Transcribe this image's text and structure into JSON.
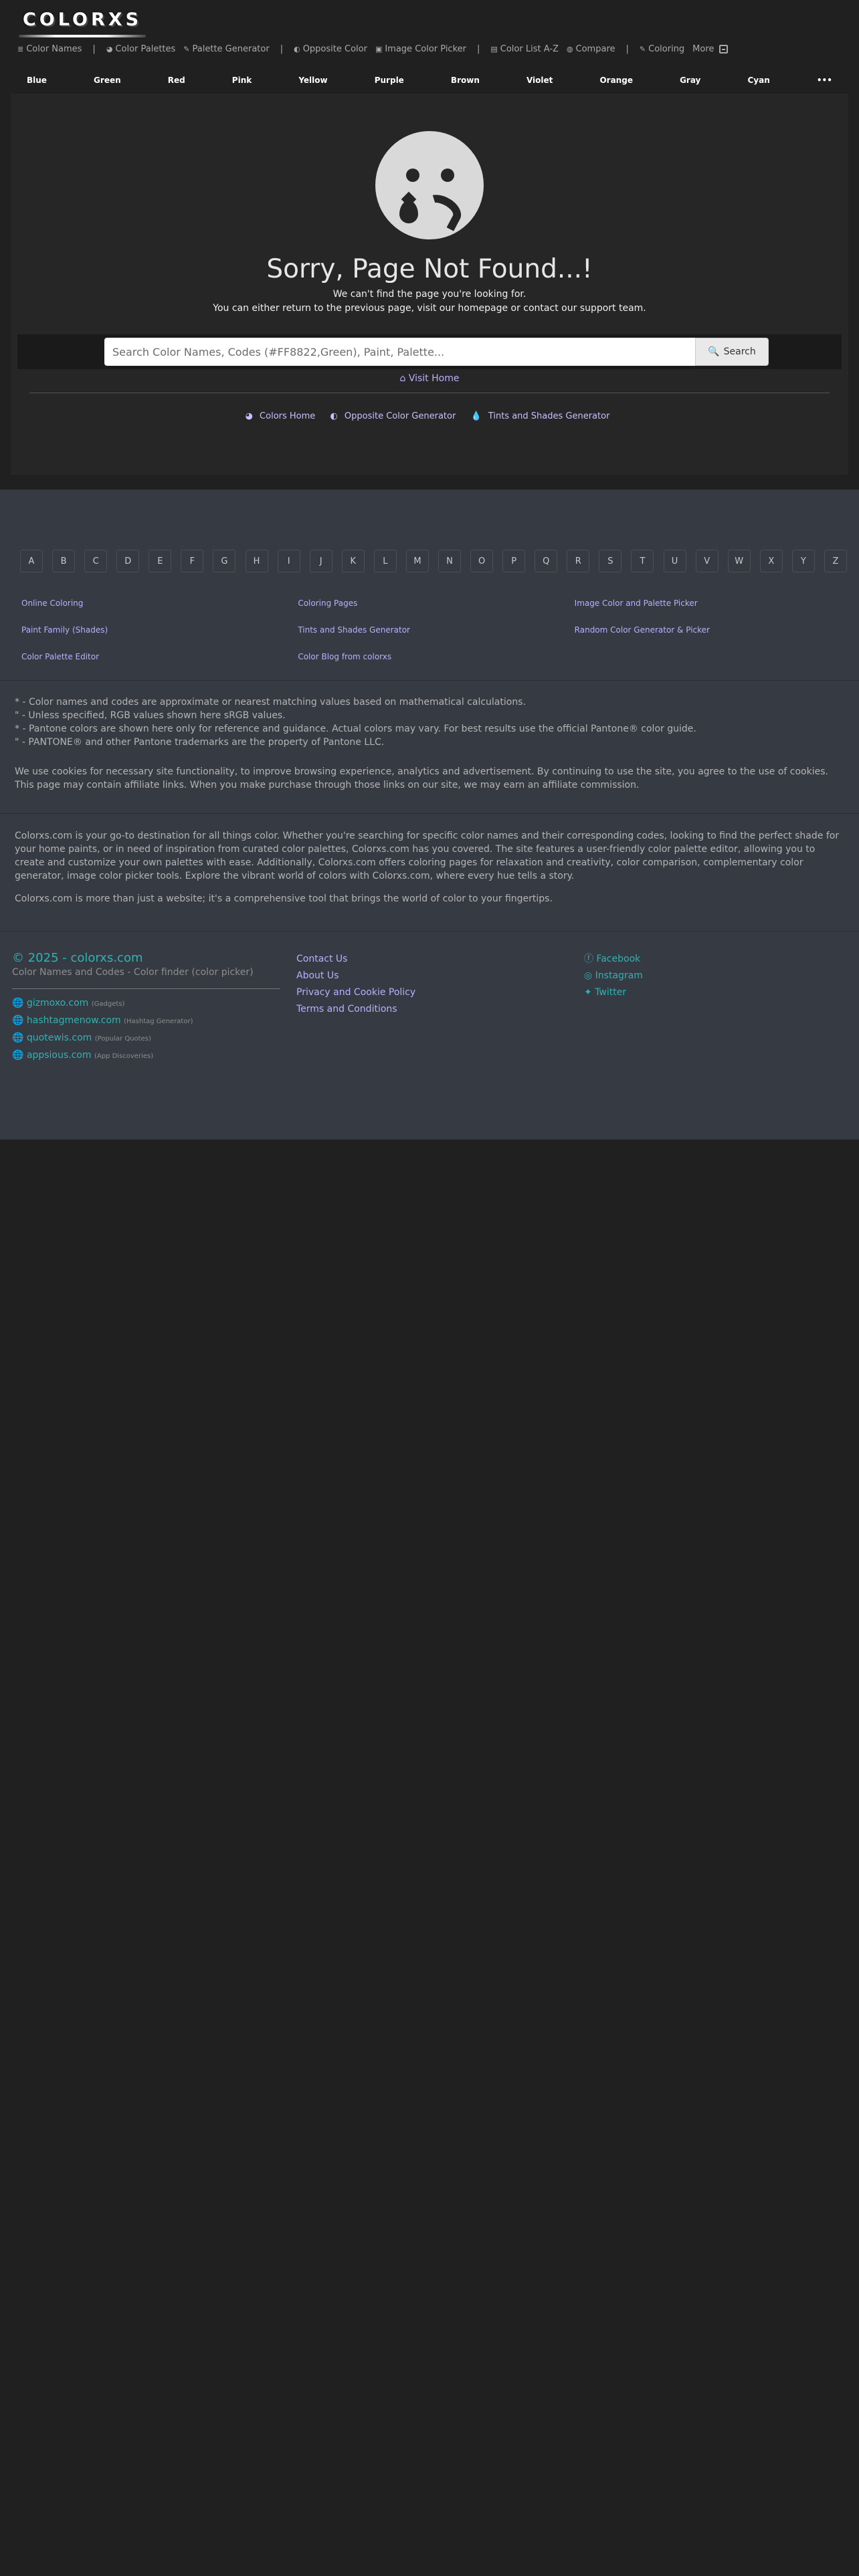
{
  "logo": "COLORXS",
  "topnav": {
    "items": [
      {
        "icon": "list-icon",
        "glyph": "≣",
        "label": "Color Names"
      },
      {
        "sep": "|"
      },
      {
        "icon": "palette-icon",
        "glyph": "◕",
        "label": "Color Palettes"
      },
      {
        "icon": "brush-icon",
        "glyph": "✎",
        "label": "Palette Generator"
      },
      {
        "sep": "|"
      },
      {
        "icon": "adjust-icon",
        "glyph": "◐",
        "label": "Opposite Color"
      },
      {
        "icon": "image-icon",
        "glyph": "▣",
        "label": "Image Color Picker"
      },
      {
        "sep": "|"
      },
      {
        "icon": "list-alt-icon",
        "glyph": "▤",
        "label": "Color List A-Z"
      },
      {
        "icon": "compare-icon",
        "glyph": "◍",
        "label": "Compare"
      },
      {
        "sep": "|"
      },
      {
        "icon": "pencil-icon",
        "glyph": "✎",
        "label": "Coloring"
      },
      {
        "icon": "",
        "glyph": "",
        "label": "More"
      }
    ]
  },
  "colorbar": [
    "Blue",
    "Green",
    "Red",
    "Pink",
    "Yellow",
    "Purple",
    "Brown",
    "Violet",
    "Orange",
    "Gray",
    "Cyan",
    "•••"
  ],
  "notfound": {
    "title": "Sorry, Page Not Found...!",
    "line1": "We can't find the page you're looking for.",
    "line2": "You can either return to the previous page, visit our homepage or contact our support team."
  },
  "search": {
    "placeholder": "Search Color Names, Codes (#FF8822,Green), Paint, Palette...",
    "button": "Search"
  },
  "visit_home": "Visit Home",
  "quicklinks": [
    "Colors Home",
    "Opposite Color Generator",
    "Tints and Shades Generator"
  ],
  "alphabet": [
    "A",
    "B",
    "C",
    "D",
    "E",
    "F",
    "G",
    "H",
    "I",
    "J",
    "K",
    "L",
    "M",
    "N",
    "O",
    "P",
    "Q",
    "R",
    "S",
    "T",
    "U",
    "V",
    "W",
    "X",
    "Y",
    "Z"
  ],
  "footer_links": [
    [
      "Online Coloring",
      "Coloring Pages",
      "Image Color and Palette Picker"
    ],
    [
      "Paint Family (Shades)",
      "Tints and Shades Generator",
      "Random Color Generator & Picker"
    ],
    [
      "Color Palette Editor",
      "Color Blog from colorxs",
      ""
    ]
  ],
  "notes": [
    "* - Color names and codes are approximate or nearest matching values based on mathematical calculations.",
    "\" - Unless specified, RGB values shown here sRGB values.",
    "* - Pantone colors are shown here only for reference and guidance. Actual colors may vary. For best results use the official Pantone® color guide.",
    "\" - PANTONE® and other Pantone trademarks are the property of Pantone LLC."
  ],
  "cookie": "We use cookies for necessary site functionality, to improve browsing experience, analytics and advertisement. By continuing to use the site, you agree to the use of cookies. This page may contain affiliate links. When you make purchase through those links on our site, we may earn an affiliate commission.",
  "about": "Colorxs.com is your go-to destination for all things color. Whether you're searching for specific color names and their corresponding codes, looking to find the perfect shade for your home paints, or in need of inspiration from curated color palettes, Colorxs.com has you covered. The site features a user-friendly color palette editor, allowing you to create and customize your own palettes with ease. Additionally, Colorxs.com offers coloring pages for relaxation and creativity, color comparison, complementary color generator, image color picker tools. Explore the vibrant world of colors with Colorxs.com, where every hue tells a story.",
  "about2": "Colorxs.com is more than just a website; it's a comprehensive tool that brings the world of color to your fingertips.",
  "copyright": "© 2025 - colorxs.com",
  "copyright_sub": "Color Names and Codes - Color finder (color picker)",
  "sites": [
    {
      "name": "gizmoxo.com",
      "note": "(Gadgets)"
    },
    {
      "name": "hashtagmenow.com",
      "note": "(Hashtag Generator)"
    },
    {
      "name": "quotewis.com",
      "note": "(Popular Quotes)"
    },
    {
      "name": "appsious.com",
      "note": "(App Discoveries)"
    }
  ],
  "mid_links": [
    "Contact Us",
    "About Us",
    "Privacy and Cookie Policy",
    "Terms and Conditions"
  ],
  "social": [
    {
      "icon": "facebook-icon",
      "label": "Facebook"
    },
    {
      "icon": "instagram-icon",
      "label": "Instagram"
    },
    {
      "icon": "twitter-icon",
      "label": "Twitter"
    }
  ]
}
